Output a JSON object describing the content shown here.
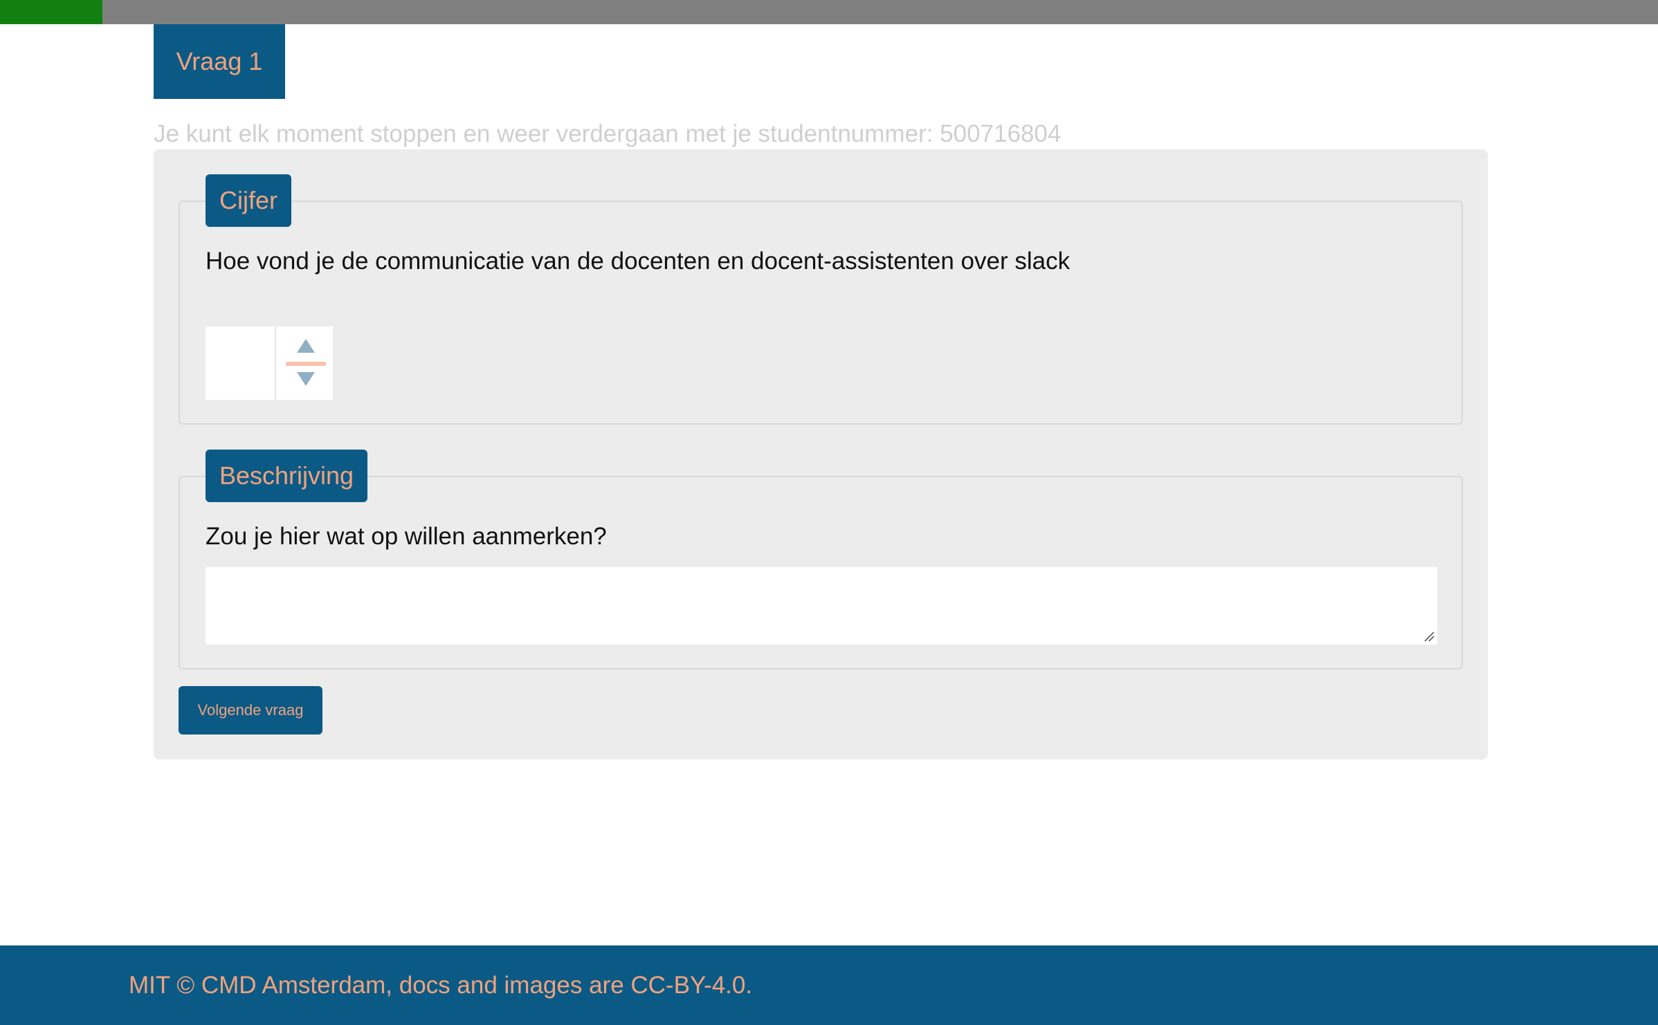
{
  "progress": {
    "fraction": 0.0618
  },
  "question_tab": {
    "label": "Vraag 1"
  },
  "resume_note": "Je kunt elk moment stoppen en weer verdergaan met je studentnummer: 500716804",
  "grade_section": {
    "legend": "Cijfer",
    "question": "Hoe vond je de communicatie van de docenten en docent-assistenten over slack",
    "value": ""
  },
  "description_section": {
    "legend": "Beschrijving",
    "question": "Zou je hier wat op willen aanmerken?",
    "value": ""
  },
  "next_button": {
    "label": "Volgende vraag"
  },
  "footer": {
    "text": "MIT © CMD Amsterdam, docs and images are CC-BY-4.0."
  },
  "colors": {
    "primary": "#0b5a85",
    "accent": "#f2a27d",
    "progress_fill": "#118011",
    "progress_track": "#808080",
    "card_bg": "#ececec",
    "muted_text": "#cfcfcf"
  },
  "icons": {
    "stepper_up": "triangle-up-icon",
    "stepper_down": "triangle-down-icon",
    "resize_grip": "resize-grip-icon"
  }
}
